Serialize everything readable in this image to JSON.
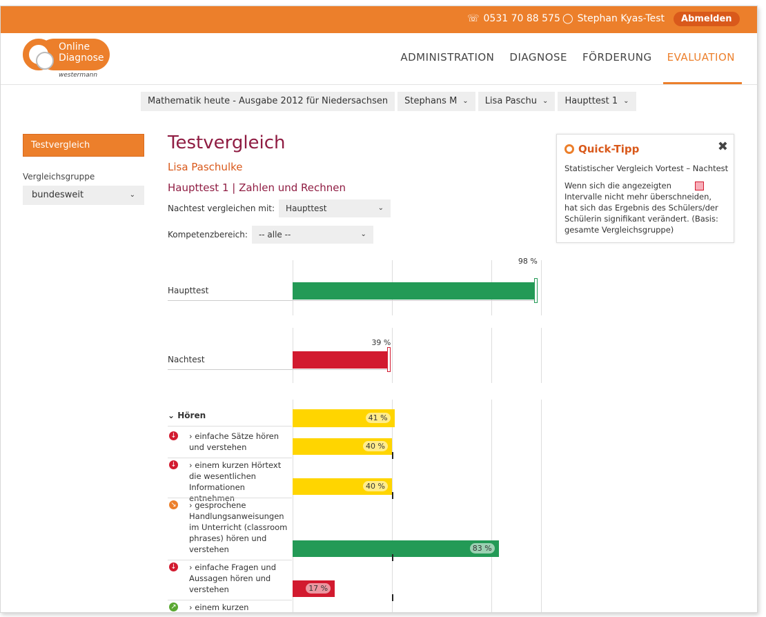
{
  "topbar": {
    "phone": "0531 70 88 575",
    "user": "Stephan Kyas-Test",
    "logout": "Abmelden"
  },
  "logo": {
    "line1": "Online",
    "line2": "Diagnose",
    "publisher": "westermann"
  },
  "nav": [
    "ADMINISTRATION",
    "DIAGNOSE",
    "FÖRDERUNG",
    "EVALUATION"
  ],
  "filters": {
    "book": "Mathematik heute - Ausgabe 2012 für Niedersachsen",
    "klass": "Stephans M",
    "student": "Lisa Paschu",
    "test": "Haupttest 1"
  },
  "sidebar": {
    "tab": "Testvergleich",
    "group_label": "Vergleichsgruppe",
    "group_value": "bundesweit"
  },
  "main": {
    "title": "Testvergleich",
    "student_name": "Lisa Paschulke",
    "test_title": "Haupttest 1 | Zahlen und Rechnen",
    "compare_label": "Nachtest vergleichen mit:",
    "compare_value": "Haupttest",
    "area_label": "Kompetenzbereich:",
    "area_value": "-- alle --"
  },
  "chart_data": {
    "type": "bar",
    "overall": [
      {
        "label": "Haupttest",
        "value": 98,
        "value_label": "98 %",
        "color": "#239a56"
      },
      {
        "label": "Nachtest",
        "value": 39,
        "value_label": "39 %",
        "color": "#d21a2f"
      }
    ],
    "section": {
      "label": "Hören",
      "value": 41,
      "value_label": "41 %"
    },
    "items": [
      {
        "label": "einfache Sätze hören und verstehen",
        "value": 40,
        "value_label": "40 %",
        "color": "#ffd500",
        "trend": "down"
      },
      {
        "label": "einem kurzen Hörtext die wesentlichen Informationen entnehmen",
        "value": 40,
        "value_label": "40 %",
        "color": "#ffd500",
        "trend": "down"
      },
      {
        "label": "gesprochene Handlungsanweisungen im Unterricht (classroom phrases) hören und verstehen",
        "value": 83,
        "value_label": "83 %",
        "color": "#239a56",
        "trend": "down-right"
      },
      {
        "label": "einfache Fragen und Aussagen hören und verstehen",
        "value": 17,
        "value_label": "17 %",
        "color": "#d21a2f",
        "trend": "down"
      },
      {
        "label": "einem kurzen gesprochenen Dialog die",
        "value": null,
        "value_label": "",
        "color": "#239a56",
        "trend": "up-right"
      }
    ],
    "xlim": [
      0,
      100
    ]
  },
  "tip": {
    "title": "Quick-Tipp",
    "subtitle": "Statistischer Vergleich Vortest – Nachtest",
    "body": "Wenn sich die angezeigten Intervalle nicht mehr überschneiden, hat sich das Ergebnis des Schülers/der Schülerin signifikant verändert. (Basis: gesamte Vergleichsgruppe)"
  }
}
